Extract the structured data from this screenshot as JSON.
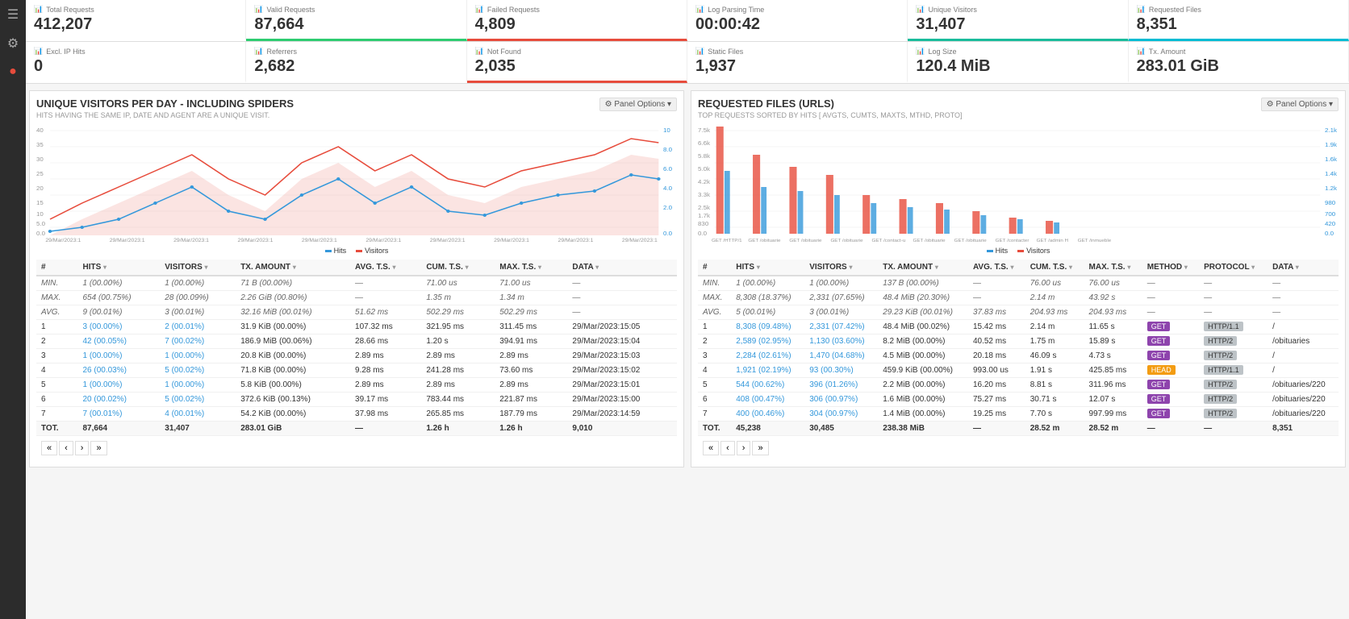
{
  "sidebar": {
    "menu_icon": "☰",
    "gear_icon": "⚙",
    "dot_icon": "●"
  },
  "stats": {
    "total_requests": {
      "label": "Total Requests",
      "value": "412,207",
      "border": ""
    },
    "valid_requests": {
      "label": "Valid Requests",
      "value": "87,664",
      "border": "green-border"
    },
    "failed_requests": {
      "label": "Failed Requests",
      "value": "4,809",
      "border": "red-border"
    },
    "log_parsing_time": {
      "label": "Log Parsing Time",
      "value": "00:00:42",
      "border": ""
    },
    "unique_visitors": {
      "label": "Unique Visitors",
      "value": "31,407",
      "border": "teal-border"
    },
    "requested_files": {
      "label": "Requested Files",
      "value": "8,351",
      "border": "cyan-border"
    },
    "excl_ip_hits": {
      "label": "Excl. IP Hits",
      "value": "0",
      "border": ""
    },
    "referrers": {
      "label": "Referrers",
      "value": "2,682",
      "border": ""
    },
    "not_found": {
      "label": "Not Found",
      "value": "2,035",
      "border": "red-border"
    },
    "static_files": {
      "label": "Static Files",
      "value": "1,937",
      "border": ""
    },
    "log_size": {
      "label": "Log Size",
      "value": "120.4 MiB",
      "border": ""
    },
    "tx_amount": {
      "label": "Tx. Amount",
      "value": "283.01 GiB",
      "border": ""
    }
  },
  "visitors_panel": {
    "title": "UNIQUE VISITORS PER DAY - INCLUDING SPIDERS",
    "subtitle": "HITS HAVING THE SAME IP, DATE AND AGENT ARE A UNIQUE VISIT.",
    "panel_options": "⚙ Panel Options ▾",
    "legend": {
      "hits": "Hits",
      "visitors": "Visitors"
    },
    "table": {
      "headers": [
        "#",
        "HITS ▾",
        "VISITORS ▾",
        "TX. AMOUNT ▾",
        "AVG. T.S. ▾",
        "CUM. T.S. ▾",
        "MAX. T.S. ▾",
        "DATA ▾"
      ],
      "min_row": [
        "MIN.",
        "1 (00.00%)",
        "1 (00.00%)",
        "71 B (00.00%)",
        "—",
        "71.00 us",
        "71.00 us",
        "—"
      ],
      "max_row": [
        "MAX.",
        "654 (00.75%)",
        "28 (00.09%)",
        "2.26 GiB (00.80%)",
        "—",
        "1.35 m",
        "1.34 m",
        "—"
      ],
      "avg_row": [
        "AVG.",
        "9 (00.01%)",
        "3 (00.01%)",
        "32.16 MiB (00.01%)",
        "51.62 ms",
        "502.29 ms",
        "502.29 ms",
        "—"
      ],
      "rows": [
        [
          "1",
          "3 (00.00%)",
          "2 (00.01%)",
          "31.9 KiB (00.00%)",
          "107.32 ms",
          "321.95 ms",
          "311.45 ms",
          "29/Mar/2023:15:05"
        ],
        [
          "2",
          "42 (00.05%)",
          "7 (00.02%)",
          "186.9 MiB (00.06%)",
          "28.66 ms",
          "1.20 s",
          "394.91 ms",
          "29/Mar/2023:15:04"
        ],
        [
          "3",
          "1 (00.00%)",
          "1 (00.00%)",
          "20.8 KiB (00.00%)",
          "2.89 ms",
          "2.89 ms",
          "2.89 ms",
          "29/Mar/2023:15:03"
        ],
        [
          "4",
          "26 (00.03%)",
          "5 (00.02%)",
          "71.8 KiB (00.00%)",
          "9.28 ms",
          "241.28 ms",
          "73.60 ms",
          "29/Mar/2023:15:02"
        ],
        [
          "5",
          "1 (00.00%)",
          "1 (00.00%)",
          "5.8 KiB (00.00%)",
          "2.89 ms",
          "2.89 ms",
          "2.89 ms",
          "29/Mar/2023:15:01"
        ],
        [
          "6",
          "20 (00.02%)",
          "5 (00.02%)",
          "372.6 KiB (00.13%)",
          "39.17 ms",
          "783.44 ms",
          "221.87 ms",
          "29/Mar/2023:15:00"
        ],
        [
          "7",
          "7 (00.01%)",
          "4 (00.01%)",
          "54.2 KiB (00.00%)",
          "37.98 ms",
          "265.85 ms",
          "187.79 ms",
          "29/Mar/2023:14:59"
        ]
      ],
      "tot_row": [
        "TOT.",
        "87,664",
        "31,407",
        "283.01 GiB",
        "—",
        "1.26 h",
        "1.26 h",
        "9,010"
      ]
    }
  },
  "files_panel": {
    "title": "REQUESTED FILES (URLS)",
    "subtitle": "TOP REQUESTS SORTED BY HITS [ AVGTS, CUMTS, MAXTS, MTHD, PROTO]",
    "panel_options": "⚙ Panel Options ▾",
    "legend": {
      "hits": "Hits",
      "visitors": "Visitors"
    },
    "table": {
      "headers": [
        "#",
        "HITS ▾",
        "VISITORS ▾",
        "TX. AMOUNT ▾",
        "AVG. T.S. ▾",
        "CUM. T.S. ▾",
        "MAX. T.S. ▾",
        "METHOD ▾",
        "PROTOCOL ▾",
        "DATA ▾"
      ],
      "min_row": [
        "MIN.",
        "1 (00.00%)",
        "1 (00.00%)",
        "137 B (00.00%)",
        "—",
        "76.00 us",
        "76.00 us",
        "—",
        "—",
        "—"
      ],
      "max_row": [
        "MAX.",
        "8,308 (18.37%)",
        "2,331 (07.65%)",
        "48.4 MiB (20.30%)",
        "—",
        "2.14 m",
        "43.92 s",
        "—",
        "—",
        "—"
      ],
      "avg_row": [
        "AVG.",
        "5 (00.01%)",
        "3 (00.01%)",
        "29.23 KiB (00.01%)",
        "37.83 ms",
        "204.93 ms",
        "204.93 ms",
        "—",
        "—",
        "—"
      ],
      "rows": [
        [
          "1",
          "8,308 (09.48%)",
          "2,331 (07.42%)",
          "48.4 MiB (00.02%)",
          "15.42 ms",
          "2.14 m",
          "11.65 s",
          "GET",
          "HTTP/1.1",
          "/"
        ],
        [
          "2",
          "2,589 (02.95%)",
          "1,130 (03.60%)",
          "8.2 MiB (00.00%)",
          "40.52 ms",
          "1.75 m",
          "15.89 s",
          "GET",
          "HTTP/2",
          "/obituaries"
        ],
        [
          "3",
          "2,284 (02.61%)",
          "1,470 (04.68%)",
          "4.5 MiB (00.00%)",
          "20.18 ms",
          "46.09 s",
          "4.73 s",
          "GET",
          "HTTP/2",
          "/"
        ],
        [
          "4",
          "1,921 (02.19%)",
          "93 (00.30%)",
          "459.9 KiB (00.00%)",
          "993.00 us",
          "1.91 s",
          "425.85 ms",
          "HEAD",
          "HTTP/1.1",
          "/"
        ],
        [
          "5",
          "544 (00.62%)",
          "396 (01.26%)",
          "2.2 MiB (00.00%)",
          "16.20 ms",
          "8.81 s",
          "311.96 ms",
          "GET",
          "HTTP/2",
          "/obituaries/220"
        ],
        [
          "6",
          "408 (00.47%)",
          "306 (00.97%)",
          "1.6 MiB (00.00%)",
          "75.27 ms",
          "30.71 s",
          "12.07 s",
          "GET",
          "HTTP/2",
          "/obituaries/220"
        ],
        [
          "7",
          "400 (00.46%)",
          "304 (00.97%)",
          "1.4 MiB (00.00%)",
          "19.25 ms",
          "7.70 s",
          "997.99 ms",
          "GET",
          "HTTP/2",
          "/obituaries/220"
        ]
      ],
      "tot_row": [
        "TOT.",
        "45,238",
        "30,485",
        "238.38 MiB",
        "—",
        "28.52 m",
        "28.52 m",
        "—",
        "—",
        "8,351"
      ]
    }
  }
}
